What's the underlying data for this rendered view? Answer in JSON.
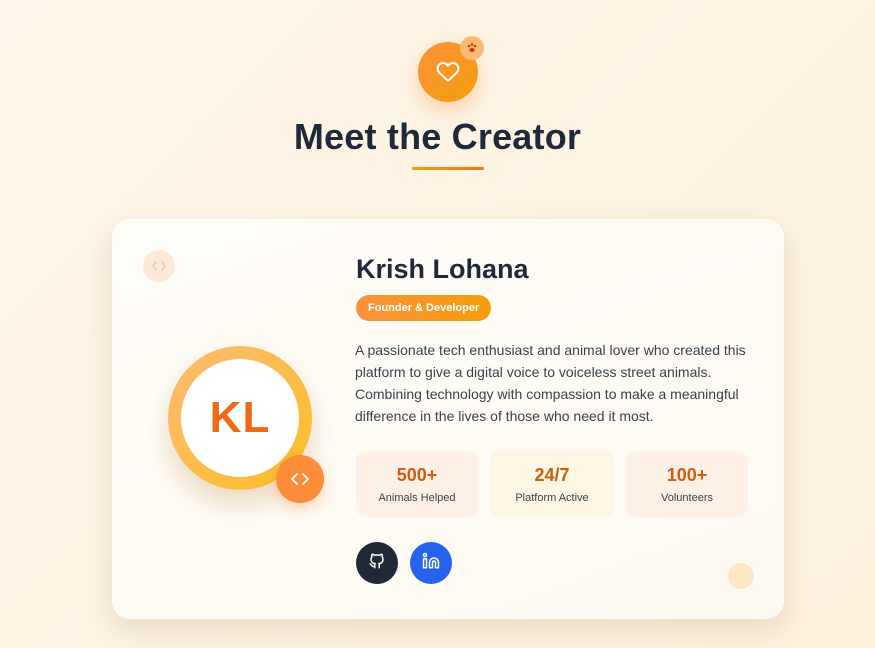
{
  "header": {
    "title": "Meet the Creator",
    "icon": "heart-icon",
    "badge_icon": "paw-icon"
  },
  "creator": {
    "initials": "KL",
    "name": "Krish Lohana",
    "role": "Founder & Developer",
    "bio": "A passionate tech enthusiast and animal lover who created this platform to give a digital voice to voiceless street animals. Combining technology with compassion to make a meaningful difference in the lives of those who need it most."
  },
  "stats": [
    {
      "value": "500+",
      "label": "Animals Helped"
    },
    {
      "value": "24/7",
      "label": "Platform Active"
    },
    {
      "value": "100+",
      "label": "Volunteers"
    }
  ],
  "social": [
    {
      "name": "GitHub",
      "icon": "github-icon",
      "color": "#1f2937"
    },
    {
      "name": "LinkedIn",
      "icon": "linkedin-icon",
      "color": "#2563eb"
    }
  ],
  "colors": {
    "accent": "#f97316",
    "accent_secondary": "#f59e0b",
    "title": "#1e293b"
  }
}
